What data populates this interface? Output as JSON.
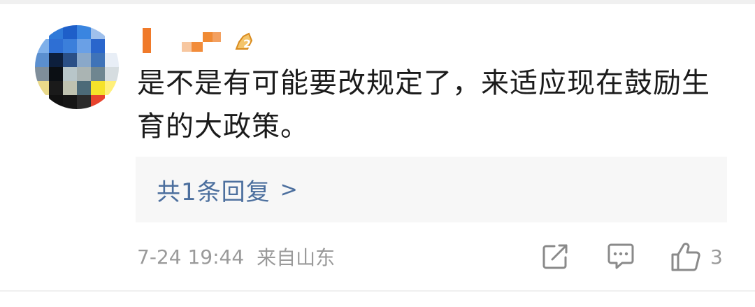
{
  "comment": {
    "username_masked": "",
    "badge": "2",
    "text": "是不是有可能要改规定了，来适应现在鼓励生育的大政策。",
    "reply_link": "共1条回复",
    "reply_chevron": ">",
    "time": "7-24 19:44",
    "location": "来自山东",
    "like_count": "3"
  },
  "icons": {
    "share": "share-edit-icon",
    "comment": "comment-bubble-icon",
    "like": "thumbs-up-icon",
    "badge": "fan-badge-icon"
  },
  "colors": {
    "text": "#1b1b1b",
    "link": "#4c6f9e",
    "meta": "#9a9a9a",
    "reply_bg": "#f7f7f7",
    "username_mosaic": "#f28c3a"
  },
  "avatar_mosaic": [
    [
      "#ffffff",
      "#2f7ad9",
      "#1e5fc9",
      "#3a85e0",
      "#9fc0ec",
      "#ffffff"
    ],
    [
      "#7fb0ea",
      "#2e6fd4",
      "#3b7fdb",
      "#6aa0e6",
      "#2a66cc",
      "#ffffff"
    ],
    [
      "#5b8fcf",
      "#0d1f3d",
      "#2a4f86",
      "#8aa8c9",
      "#3f73b8",
      "#e8eef6"
    ],
    [
      "#7f8e9a",
      "#0b0f14",
      "#b8c6c9",
      "#aab4b3",
      "#6f8690",
      "#d6dde0"
    ],
    [
      "#e9d98a",
      "#1a1a1a",
      "#bfc2b0",
      "#4c6a78",
      "#f5e22a",
      "#fff07a"
    ],
    [
      "#ffffff",
      "#111111",
      "#161616",
      "#2b2b2b",
      "#e8432d",
      "#ffffff"
    ]
  ]
}
